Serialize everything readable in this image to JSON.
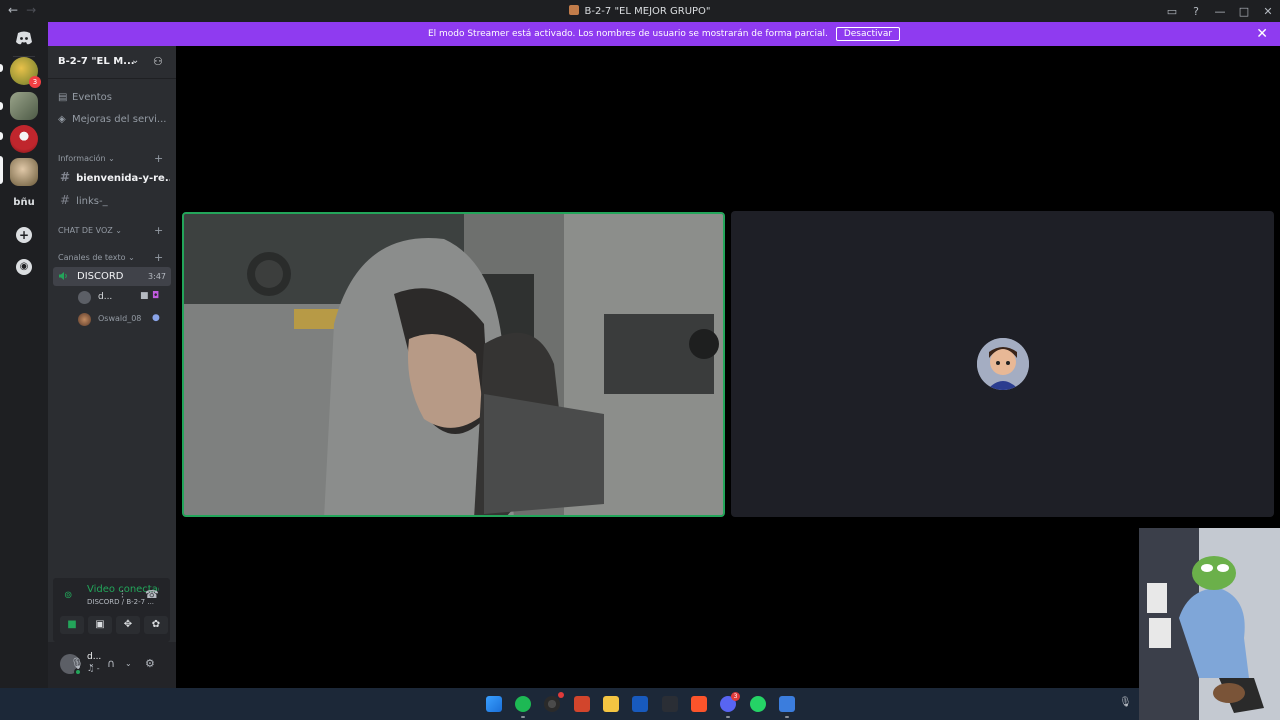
{
  "window": {
    "title": "B-2-7 \"EL MEJOR GRUPO\"",
    "back_icon": "←",
    "forward_icon": "→"
  },
  "banner": {
    "message": "El modo Streamer está activado. Los nombres de usuario se mostrarán de forma parcial.",
    "button": "Desactivar",
    "close": "✕"
  },
  "rail": {
    "server_badge": "3",
    "text_server": "bñu"
  },
  "server": {
    "name": "B-2-7 \"EL M...",
    "events": "Eventos",
    "boosts": "Mejoras del servi...",
    "categories": [
      {
        "label": "Información ⌄"
      },
      {
        "label": "CHAT DE VOZ ⌄"
      },
      {
        "label": "Canales de texto ⌄"
      }
    ],
    "channels": [
      {
        "name": "bienvenida-y-re..."
      },
      {
        "name": "links-_"
      }
    ],
    "voice": {
      "name": "DISCORD",
      "time": "3:47",
      "members": [
        {
          "name": "d..."
        },
        {
          "name": "Oswald_08"
        }
      ]
    }
  },
  "rtc": {
    "status": "Video conectado",
    "sub": "DISCORD / B-2-7 ..."
  },
  "user": {
    "name": "d...",
    "status": "♫ -"
  },
  "colors": {
    "banner": "#8f3bf0",
    "connected": "#23a55a",
    "sidebar": "#2b2d31",
    "rail": "#1e1f22",
    "taskbar": "#1c2838"
  },
  "taskbar": {
    "chrome_badge": "",
    "discord_badge": "3"
  }
}
